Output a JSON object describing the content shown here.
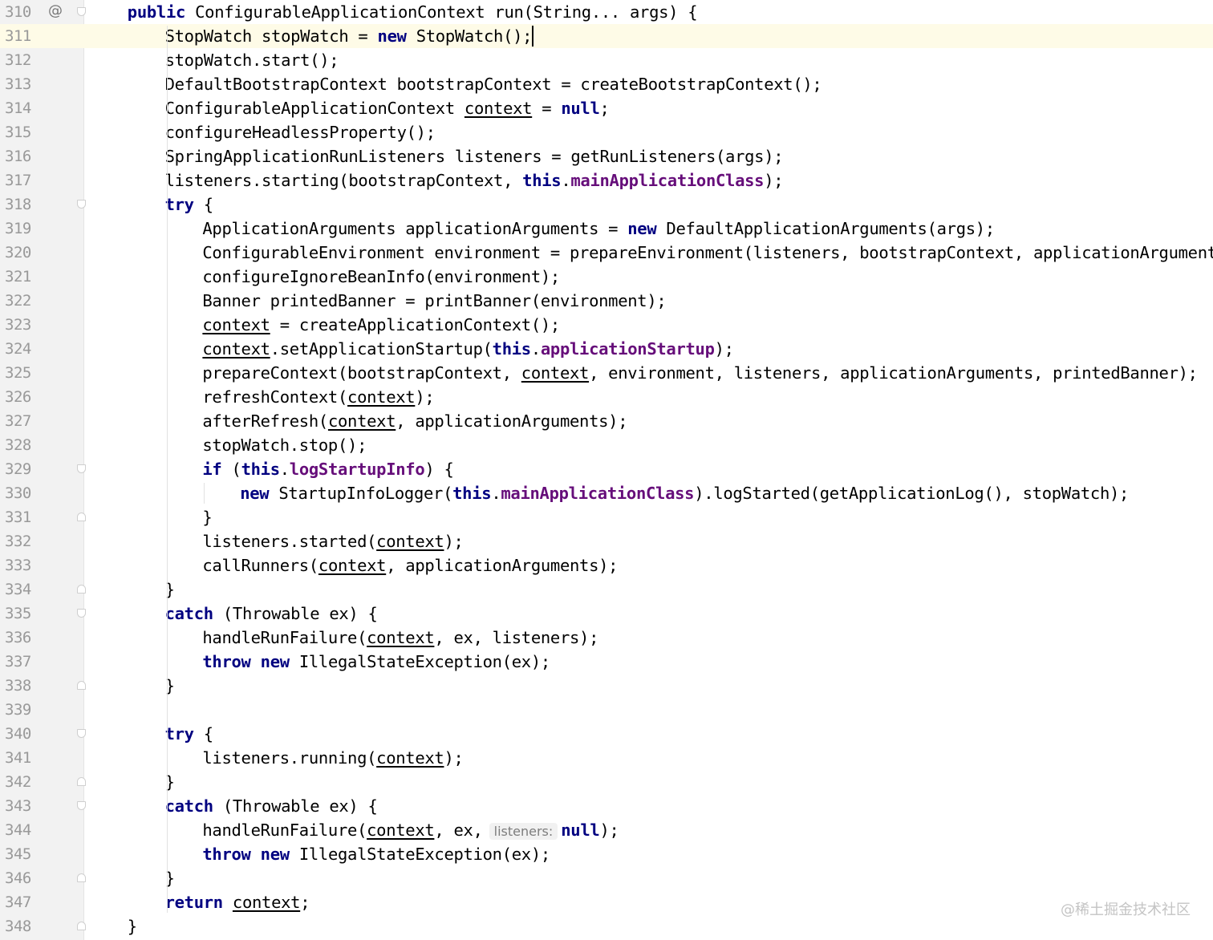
{
  "editor": {
    "language": "java",
    "current_line": 311,
    "colors": {
      "keyword": "#000080",
      "field": "#660e7a",
      "text": "#000000",
      "line_number": "#999999",
      "gutter_background": "#f2f2f2",
      "current_line_background": "#fefbe7"
    },
    "lines": [
      {
        "number": "310",
        "indent": 1,
        "gutter_icon": "@",
        "fold": "open",
        "tokens": [
          {
            "t": "public",
            "s": "kw"
          },
          {
            "t": " ConfigurableApplicationContext run(String... args) {"
          }
        ]
      },
      {
        "number": "311",
        "indent": 2,
        "current": true,
        "caret": true,
        "tokens": [
          {
            "t": "StopWatch stopWatch = "
          },
          {
            "t": "new",
            "s": "kw"
          },
          {
            "t": " StopWatch();"
          }
        ]
      },
      {
        "number": "312",
        "indent": 2,
        "tokens": [
          {
            "t": "stopWatch.start();"
          }
        ]
      },
      {
        "number": "313",
        "indent": 2,
        "tokens": [
          {
            "t": "DefaultBootstrapContext bootstrapContext = createBootstrapContext();"
          }
        ]
      },
      {
        "number": "314",
        "indent": 2,
        "tokens": [
          {
            "t": "ConfigurableApplicationContext "
          },
          {
            "t": "context",
            "s": "var"
          },
          {
            "t": " = "
          },
          {
            "t": "null",
            "s": "kw"
          },
          {
            "t": ";"
          }
        ]
      },
      {
        "number": "315",
        "indent": 2,
        "tokens": [
          {
            "t": "configureHeadlessProperty();"
          }
        ]
      },
      {
        "number": "316",
        "indent": 2,
        "tokens": [
          {
            "t": "SpringApplicationRunListeners listeners = getRunListeners(args);"
          }
        ]
      },
      {
        "number": "317",
        "indent": 2,
        "tokens": [
          {
            "t": "listeners.starting(bootstrapContext, "
          },
          {
            "t": "this",
            "s": "kw"
          },
          {
            "t": "."
          },
          {
            "t": "mainApplicationClass",
            "s": "fld"
          },
          {
            "t": ");"
          }
        ]
      },
      {
        "number": "318",
        "indent": 2,
        "fold": "open",
        "tokens": [
          {
            "t": "try",
            "s": "kw"
          },
          {
            "t": " {"
          }
        ]
      },
      {
        "number": "319",
        "indent": 3,
        "tokens": [
          {
            "t": "ApplicationArguments applicationArguments = "
          },
          {
            "t": "new",
            "s": "kw"
          },
          {
            "t": " DefaultApplicationArguments(args);"
          }
        ]
      },
      {
        "number": "320",
        "indent": 3,
        "tokens": [
          {
            "t": "ConfigurableEnvironment environment = prepareEnvironment(listeners, bootstrapContext, applicationArguments);"
          }
        ]
      },
      {
        "number": "321",
        "indent": 3,
        "tokens": [
          {
            "t": "configureIgnoreBeanInfo(environment);"
          }
        ]
      },
      {
        "number": "322",
        "indent": 3,
        "tokens": [
          {
            "t": "Banner printedBanner = printBanner(environment);"
          }
        ]
      },
      {
        "number": "323",
        "indent": 3,
        "tokens": [
          {
            "t": "context",
            "s": "var"
          },
          {
            "t": " = createApplicationContext();"
          }
        ]
      },
      {
        "number": "324",
        "indent": 3,
        "tokens": [
          {
            "t": "context",
            "s": "var"
          },
          {
            "t": ".setApplicationStartup("
          },
          {
            "t": "this",
            "s": "kw"
          },
          {
            "t": "."
          },
          {
            "t": "applicationStartup",
            "s": "fld"
          },
          {
            "t": ");"
          }
        ]
      },
      {
        "number": "325",
        "indent": 3,
        "tokens": [
          {
            "t": "prepareContext(bootstrapContext, "
          },
          {
            "t": "context",
            "s": "var"
          },
          {
            "t": ", environment, listeners, applicationArguments, printedBanner);"
          }
        ]
      },
      {
        "number": "326",
        "indent": 3,
        "tokens": [
          {
            "t": "refreshContext("
          },
          {
            "t": "context",
            "s": "var"
          },
          {
            "t": ");"
          }
        ]
      },
      {
        "number": "327",
        "indent": 3,
        "tokens": [
          {
            "t": "afterRefresh("
          },
          {
            "t": "context",
            "s": "var"
          },
          {
            "t": ", applicationArguments);"
          }
        ]
      },
      {
        "number": "328",
        "indent": 3,
        "tokens": [
          {
            "t": "stopWatch.stop();"
          }
        ]
      },
      {
        "number": "329",
        "indent": 3,
        "fold": "open",
        "tokens": [
          {
            "t": "if",
            "s": "kw"
          },
          {
            "t": " ("
          },
          {
            "t": "this",
            "s": "kw"
          },
          {
            "t": "."
          },
          {
            "t": "logStartupInfo",
            "s": "fld"
          },
          {
            "t": ") {"
          }
        ]
      },
      {
        "number": "330",
        "indent": 4,
        "tokens": [
          {
            "t": "new",
            "s": "kw"
          },
          {
            "t": " StartupInfoLogger("
          },
          {
            "t": "this",
            "s": "kw"
          },
          {
            "t": "."
          },
          {
            "t": "mainApplicationClass",
            "s": "fld"
          },
          {
            "t": ").logStarted(getApplicationLog(), stopWatch);"
          }
        ]
      },
      {
        "number": "331",
        "indent": 3,
        "fold": "close",
        "tokens": [
          {
            "t": "}"
          }
        ]
      },
      {
        "number": "332",
        "indent": 3,
        "tokens": [
          {
            "t": "listeners.started("
          },
          {
            "t": "context",
            "s": "var"
          },
          {
            "t": ");"
          }
        ]
      },
      {
        "number": "333",
        "indent": 3,
        "tokens": [
          {
            "t": "callRunners("
          },
          {
            "t": "context",
            "s": "var"
          },
          {
            "t": ", applicationArguments);"
          }
        ]
      },
      {
        "number": "334",
        "indent": 2,
        "fold": "close",
        "tokens": [
          {
            "t": "}"
          }
        ]
      },
      {
        "number": "335",
        "indent": 2,
        "fold": "open",
        "tokens": [
          {
            "t": "catch",
            "s": "kw"
          },
          {
            "t": " (Throwable ex) {"
          }
        ]
      },
      {
        "number": "336",
        "indent": 3,
        "tokens": [
          {
            "t": "handleRunFailure("
          },
          {
            "t": "context",
            "s": "var"
          },
          {
            "t": ", ex, listeners);"
          }
        ]
      },
      {
        "number": "337",
        "indent": 3,
        "tokens": [
          {
            "t": "throw",
            "s": "kw"
          },
          {
            "t": " "
          },
          {
            "t": "new",
            "s": "kw"
          },
          {
            "t": " IllegalStateException(ex);"
          }
        ]
      },
      {
        "number": "338",
        "indent": 2,
        "fold": "close",
        "tokens": [
          {
            "t": "}"
          }
        ]
      },
      {
        "number": "339",
        "indent": 2,
        "tokens": []
      },
      {
        "number": "340",
        "indent": 2,
        "fold": "open",
        "tokens": [
          {
            "t": "try",
            "s": "kw"
          },
          {
            "t": " {"
          }
        ]
      },
      {
        "number": "341",
        "indent": 3,
        "tokens": [
          {
            "t": "listeners.running("
          },
          {
            "t": "context",
            "s": "var"
          },
          {
            "t": ");"
          }
        ]
      },
      {
        "number": "342",
        "indent": 2,
        "fold": "close",
        "tokens": [
          {
            "t": "}"
          }
        ]
      },
      {
        "number": "343",
        "indent": 2,
        "fold": "open",
        "tokens": [
          {
            "t": "catch",
            "s": "kw"
          },
          {
            "t": " (Throwable ex) {"
          }
        ]
      },
      {
        "number": "344",
        "indent": 3,
        "tokens": [
          {
            "t": "handleRunFailure("
          },
          {
            "t": "context",
            "s": "var"
          },
          {
            "t": ", ex,"
          },
          {
            "t": "listeners:",
            "s": "hint"
          },
          {
            "t": "null",
            "s": "kw"
          },
          {
            "t": ");"
          }
        ]
      },
      {
        "number": "345",
        "indent": 3,
        "tokens": [
          {
            "t": "throw",
            "s": "kw"
          },
          {
            "t": " "
          },
          {
            "t": "new",
            "s": "kw"
          },
          {
            "t": " IllegalStateException(ex);"
          }
        ]
      },
      {
        "number": "346",
        "indent": 2,
        "fold": "close",
        "tokens": [
          {
            "t": "}"
          }
        ]
      },
      {
        "number": "347",
        "indent": 2,
        "tokens": [
          {
            "t": "return",
            "s": "kw"
          },
          {
            "t": " "
          },
          {
            "t": "context",
            "s": "var"
          },
          {
            "t": ";"
          }
        ]
      },
      {
        "number": "348",
        "indent": 1,
        "fold": "close",
        "tokens": [
          {
            "t": "}"
          }
        ]
      }
    ]
  },
  "watermark": "@稀土掘金技术社区"
}
